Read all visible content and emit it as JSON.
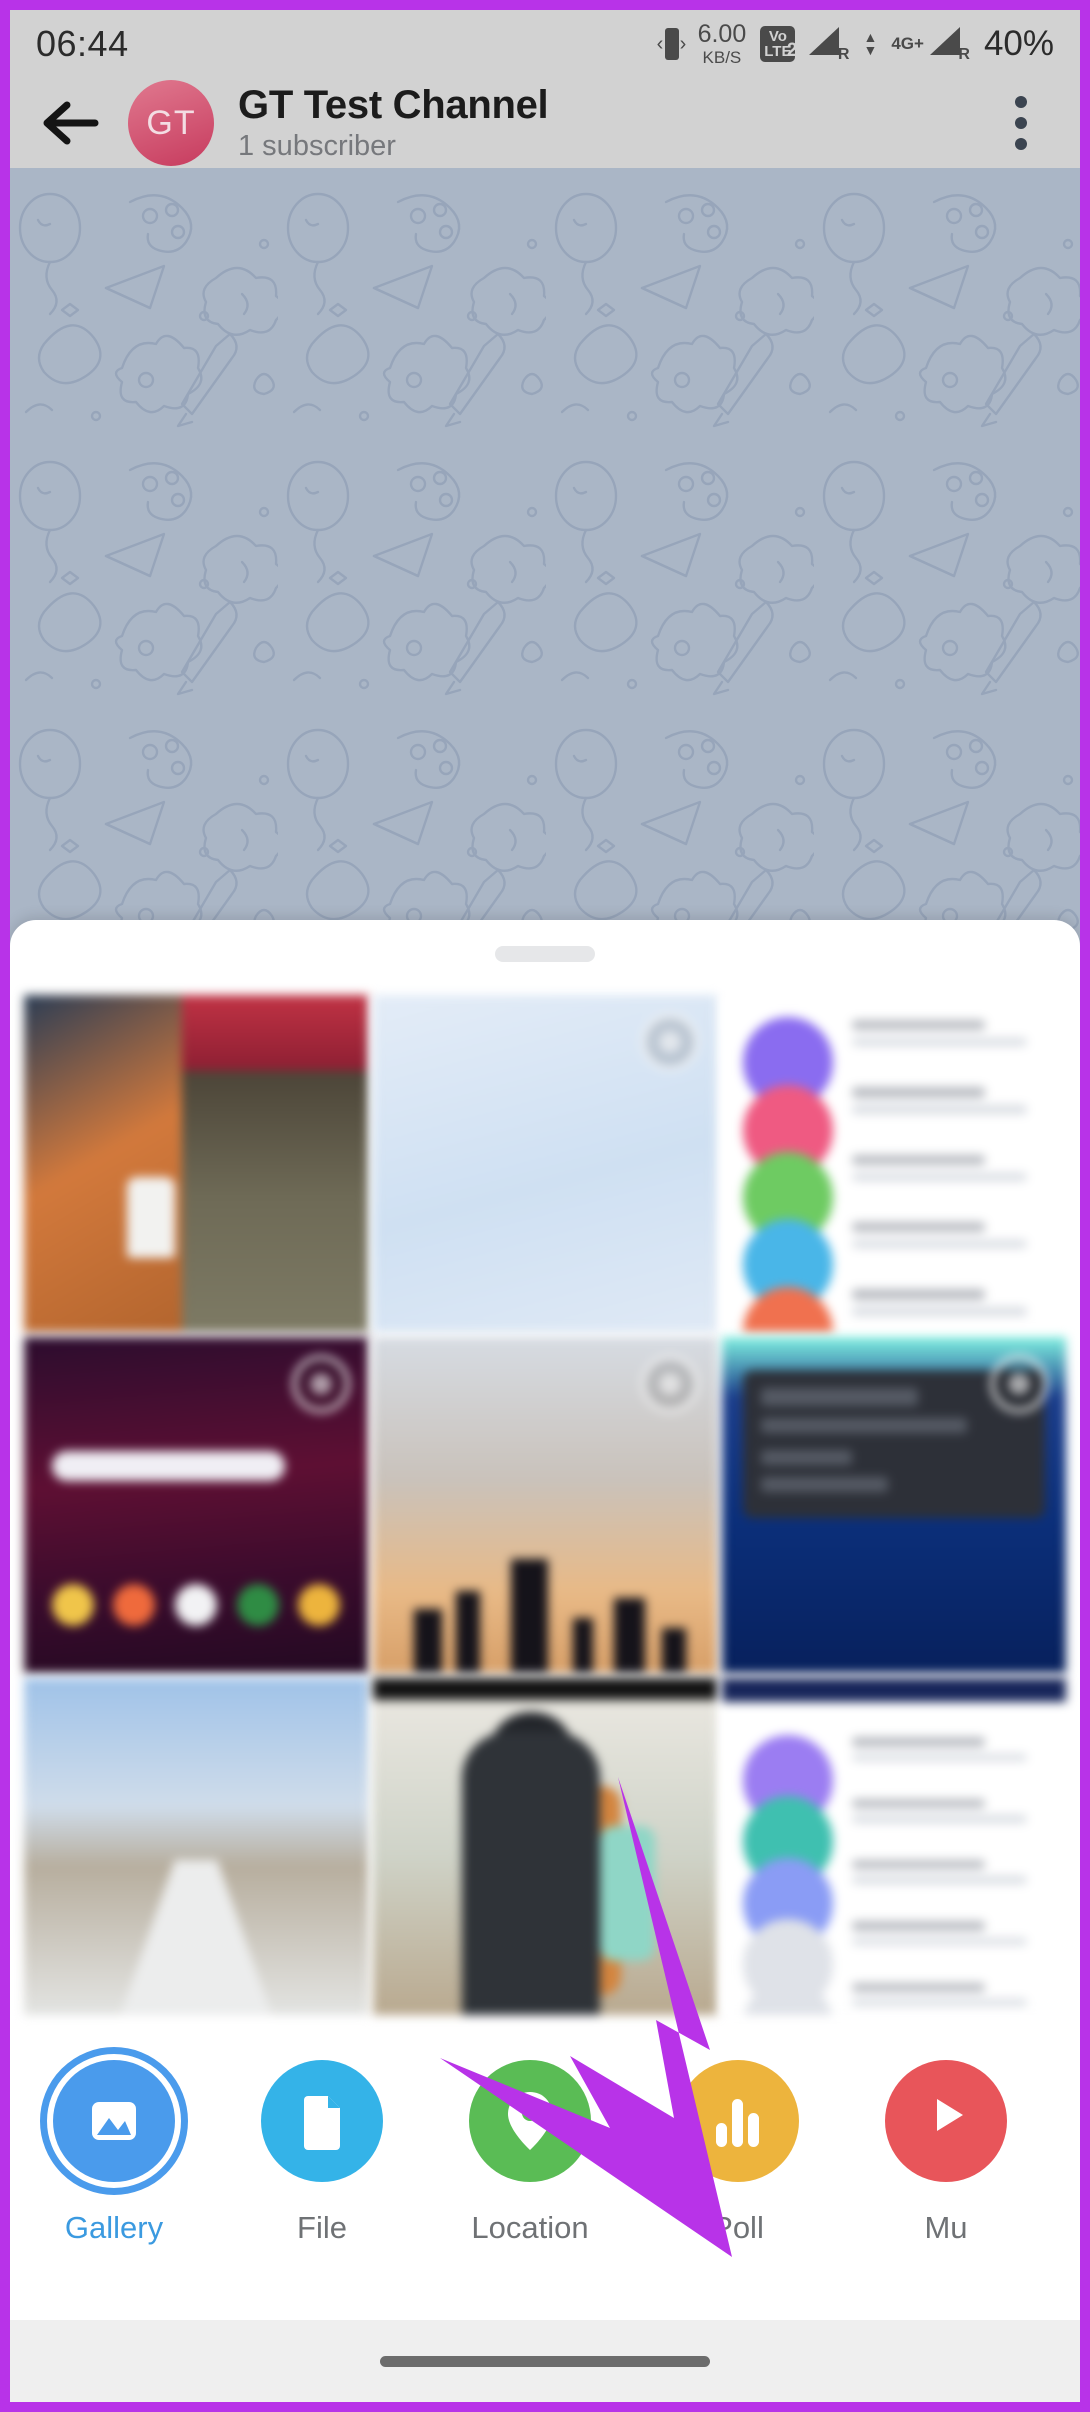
{
  "status_bar": {
    "clock": "06:44",
    "vibrate_icon": "vibrate-icon",
    "net_speed_value": "6.00",
    "net_speed_unit": "KB/S",
    "volte_top": "Vo",
    "volte_bottom": "LTE",
    "volte_sim": "2",
    "sim1_roaming": "R",
    "sim2_roaming": "R",
    "network_type": "4G+",
    "battery": "40%"
  },
  "header": {
    "back_icon": "back-arrow-icon",
    "avatar_initials": "GT",
    "title": "GT Test Channel",
    "subtitle": "1 subscriber",
    "menu_icon": "more-vertical-icon"
  },
  "sheet": {
    "drag_handle": "drag-handle",
    "photos": [
      {
        "name": "photo-chair",
        "selected": false
      },
      {
        "name": "photo-light",
        "selected": true
      },
      {
        "name": "photo-chatlist",
        "selected": false
      },
      {
        "name": "photo-purple-ui",
        "selected": true
      },
      {
        "name": "photo-skyline",
        "selected": true
      },
      {
        "name": "photo-dark-ui",
        "selected": true
      },
      {
        "name": "photo-road",
        "selected": false
      },
      {
        "name": "photo-person",
        "selected": false
      },
      {
        "name": "photo-chat2",
        "selected": false
      }
    ]
  },
  "actions": [
    {
      "label": "Gallery",
      "icon": "image-icon",
      "color": "#4a9bec",
      "active": true
    },
    {
      "label": "File",
      "icon": "document-icon",
      "color": "#34b3e8",
      "active": false
    },
    {
      "label": "Location",
      "icon": "pin-icon",
      "color": "#5abc55",
      "active": false
    },
    {
      "label": "Poll",
      "icon": "bar-chart-icon",
      "color": "#edb43d",
      "active": false
    },
    {
      "label": "Mu",
      "icon": "music-icon",
      "color": "#e8555a",
      "active": false
    }
  ],
  "annotation": {
    "arrow_name": "poll-callout-arrow",
    "arrow_color": "#b833e8",
    "border_color": "#b833e8"
  },
  "nav_bar": {
    "pill": "home-gesture-pill"
  }
}
